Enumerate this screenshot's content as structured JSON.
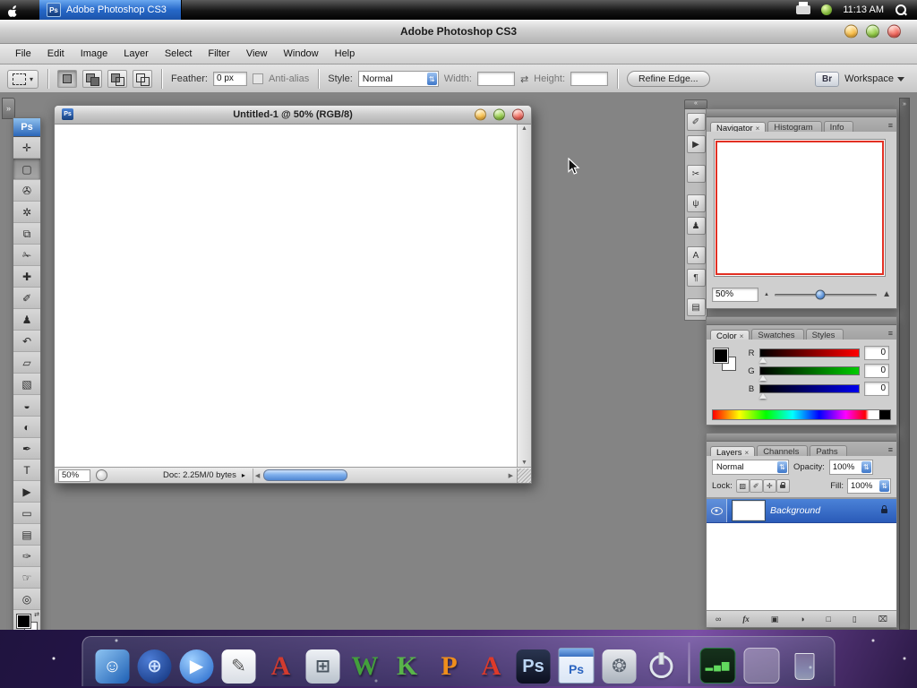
{
  "system_bar": {
    "app_tab": {
      "icon": "Ps",
      "label": "Adobe Photoshop CS3"
    },
    "time": "11:13 AM"
  },
  "app": {
    "title": "Adobe Photoshop CS3",
    "menus": [
      {
        "label": "File",
        "name": "menu-file"
      },
      {
        "label": "Edit",
        "name": "menu-edit"
      },
      {
        "label": "Image",
        "name": "menu-image"
      },
      {
        "label": "Layer",
        "name": "menu-layer"
      },
      {
        "label": "Select",
        "name": "menu-select"
      },
      {
        "label": "Filter",
        "name": "menu-filter"
      },
      {
        "label": "View",
        "name": "menu-view"
      },
      {
        "label": "Window",
        "name": "menu-window"
      },
      {
        "label": "Help",
        "name": "menu-help"
      }
    ]
  },
  "options": {
    "feather_label": "Feather:",
    "feather_value": "0 px",
    "antialias_label": "Anti-alias",
    "style_label": "Style:",
    "style_value": "Normal",
    "width_label": "Width:",
    "width_value": "",
    "height_label": "Height:",
    "height_value": "",
    "refine_edge_label": "Refine Edge...",
    "bridge_label": "Br",
    "workspace_label": "Workspace"
  },
  "toolbox": {
    "logo": "Ps",
    "tools": [
      {
        "name": "move-tool",
        "glyph": "✛"
      },
      {
        "name": "rectangular-marquee-tool",
        "glyph": "▢",
        "cls": "selected"
      },
      {
        "name": "lasso-tool",
        "glyph": "✇"
      },
      {
        "name": "magic-wand-tool",
        "glyph": "✲"
      },
      {
        "name": "crop-tool",
        "glyph": "⧉"
      },
      {
        "name": "slice-tool",
        "glyph": "✁"
      },
      {
        "name": "healing-brush-tool",
        "glyph": "✚"
      },
      {
        "name": "brush-tool",
        "glyph": "✐"
      },
      {
        "name": "clone-stamp-tool",
        "glyph": "♟"
      },
      {
        "name": "history-brush-tool",
        "glyph": "↶"
      },
      {
        "name": "eraser-tool",
        "glyph": "▱"
      },
      {
        "name": "gradient-tool",
        "glyph": "▧"
      },
      {
        "name": "blur-tool",
        "glyph": "◒"
      },
      {
        "name": "dodge-tool",
        "glyph": "◐"
      },
      {
        "name": "pen-tool",
        "glyph": "✒"
      },
      {
        "name": "type-tool",
        "glyph": "T"
      },
      {
        "name": "path-selection-tool",
        "glyph": "▶"
      },
      {
        "name": "shape-tool",
        "glyph": "▭"
      },
      {
        "name": "notes-tool",
        "glyph": "▤"
      },
      {
        "name": "eyedropper-tool",
        "glyph": "✑"
      },
      {
        "name": "hand-tool",
        "glyph": "☞"
      },
      {
        "name": "zoom-tool",
        "glyph": "◎"
      }
    ]
  },
  "document": {
    "icon": "Ps",
    "title": "Untitled-1 @ 50% (RGB/8)",
    "zoom": "50%",
    "info": "Doc: 2.25M/0 bytes"
  },
  "palette_strip": {
    "icons": [
      {
        "name": "brushes-palette-icon",
        "glyph": "✐"
      },
      {
        "name": "tool-presets-palette-icon",
        "glyph": "▶"
      },
      {
        "name": "clone-source-palette-icon",
        "glyph": "✂"
      },
      {
        "name": "swatches-palette-icon",
        "glyph": "ψ"
      },
      {
        "name": "pattern-palette-icon",
        "glyph": "♟"
      },
      {
        "name": "character-palette-icon",
        "glyph": "A"
      },
      {
        "name": "paragraph-palette-icon",
        "glyph": "¶"
      },
      {
        "name": "layer-comps-palette-icon",
        "glyph": "▤"
      }
    ]
  },
  "navigator": {
    "tabs": [
      {
        "label": "Navigator",
        "close": "×",
        "cls": "active",
        "name": "tab-navigator"
      },
      {
        "label": "Histogram",
        "name": "tab-histogram"
      },
      {
        "label": "Info",
        "name": "tab-info"
      }
    ],
    "zoom_value": "50%"
  },
  "color": {
    "tabs": [
      {
        "label": "Color",
        "close": "×",
        "cls": "active",
        "name": "tab-color"
      },
      {
        "label": "Swatches",
        "name": "tab-swatches"
      },
      {
        "label": "Styles",
        "name": "tab-styles"
      }
    ],
    "channels": [
      {
        "label": "R",
        "value": "0",
        "cls": "red",
        "name": "red-channel-row"
      },
      {
        "label": "G",
        "value": "0",
        "cls": "green",
        "name": "green-channel-row"
      },
      {
        "label": "B",
        "value": "0",
        "cls": "blue",
        "name": "blue-channel-row"
      }
    ]
  },
  "layers": {
    "tabs": [
      {
        "label": "Layers",
        "close": "×",
        "cls": "active",
        "name": "tab-layers"
      },
      {
        "label": "Channels",
        "name": "tab-channels"
      },
      {
        "label": "Paths",
        "name": "tab-paths"
      }
    ],
    "blend_mode": "Normal",
    "opacity_label": "Opacity:",
    "opacity_value": "100%",
    "lock_label": "Lock:",
    "lock_icons": [
      {
        "name": "lock-transparency-icon",
        "glyph": "▨"
      },
      {
        "name": "lock-image-icon",
        "glyph": "✐"
      },
      {
        "name": "lock-position-icon",
        "glyph": "✛"
      },
      {
        "name": "lock-all-icon",
        "glyph": "",
        "cls": "padlock"
      }
    ],
    "fill_label": "Fill:",
    "fill_value": "100%",
    "layers": [
      {
        "name": "Background"
      }
    ],
    "footer_icons": [
      {
        "name": "link-layers-icon",
        "glyph": "∞"
      },
      {
        "name": "layer-style-icon",
        "glyph": "fx",
        "cls": "fx"
      },
      {
        "name": "add-layer-mask-icon",
        "glyph": "▣"
      },
      {
        "name": "adjustment-layer-icon",
        "glyph": "◑"
      },
      {
        "name": "new-group-icon",
        "glyph": "□"
      },
      {
        "name": "new-layer-icon",
        "glyph": "▯"
      },
      {
        "name": "delete-layer-icon",
        "glyph": "⌧"
      }
    ]
  },
  "dock": {
    "items": [
      {
        "name": "finder-dock-icon",
        "glyph": "☺",
        "bg": "linear-gradient(135deg,#8ec4f2,#1d5fb4)",
        "fg": "#ffffff"
      },
      {
        "name": "browser-dock-icon",
        "glyph": "⊕",
        "bg": "radial-gradient(circle at 35% 30%,#4d7dd6,#0f2f77)",
        "fg": "#cfe2ff",
        "cls": "round"
      },
      {
        "name": "quicktime-dock-icon",
        "glyph": "▶",
        "bg": "radial-gradient(circle at 35% 30%,#9fd0ff,#1f63c8)",
        "fg": "#ffffff",
        "cls": "round"
      },
      {
        "name": "textedit-dock-icon",
        "glyph": "✎",
        "bg": "linear-gradient(#ffffff,#d8dde4)",
        "fg": "#555555"
      },
      {
        "name": "fontbook-dock-icon",
        "glyph": "A",
        "fg": "#d23b2f",
        "cls": "letter"
      },
      {
        "name": "calculator-dock-icon",
        "glyph": "⊞",
        "bg": "linear-gradient(#eef1f5,#b9c2cc)",
        "fg": "#4a5560"
      },
      {
        "name": "office-writer-dock-icon",
        "glyph": "W",
        "fg": "#43a03c",
        "cls": "letter"
      },
      {
        "name": "office-calc-dock-icon",
        "glyph": "K",
        "fg": "#59b34a",
        "cls": "letter"
      },
      {
        "name": "office-impress-dock-icon",
        "glyph": "P",
        "fg": "#ef8e1b",
        "cls": "letter"
      },
      {
        "name": "abiword-dock-icon",
        "glyph": "A",
        "fg": "#dd3a2a",
        "cls": "letter"
      },
      {
        "name": "photoshop-dock-icon",
        "glyph": "Ps",
        "bg": "linear-gradient(#2a3550,#0c1020)",
        "fg": "#bcd6f5"
      },
      {
        "name": "photoshop-document-dock-icon",
        "glyph": "Ps",
        "cls": "winicon",
        "fg": "#2b64c0"
      },
      {
        "name": "system-preferences-dock-icon",
        "glyph": "❂",
        "bg": "linear-gradient(#e8eaee,#aab2bc)",
        "fg": "#5a636e"
      },
      {
        "name": "logout-dock-icon",
        "glyph": "",
        "cls": "power"
      },
      {
        "name": "dock-separator",
        "glyph": "",
        "cls": "dsep"
      },
      {
        "name": "widget-dock-icon",
        "glyph": "▂▄▆",
        "bg": "linear-gradient(#16321c,#0a1a0e)",
        "fg": "#62d95e",
        "cls": "widget"
      },
      {
        "name": "stack-dock-icon",
        "glyph": "",
        "bg": "rgba(255,255,255,0.28)",
        "cls": "stack"
      },
      {
        "name": "trash-dock-icon",
        "glyph": "",
        "cls": "glass"
      }
    ]
  },
  "glyphs": {
    "caret_down": "▾",
    "menu_arrow": "▸",
    "collapse_left": "«",
    "collapse_right": "»",
    "swap": "⇄",
    "stepper": "⇅",
    "scroll_up": "▲",
    "scroll_down": "▼",
    "scroll_left": "◀",
    "scroll_right": "▶",
    "slider_small": "▲",
    "slider_large": "▲",
    "panel_menu": "≡"
  },
  "colors": {
    "selection_blue": "#2a5bb8",
    "navigator_proxy_red": "#e23023",
    "titlebar_yellow": "#f6b73d",
    "titlebar_green": "#8cc63e",
    "titlebar_red": "#ee5f55",
    "workspace_gray": "#848484"
  }
}
